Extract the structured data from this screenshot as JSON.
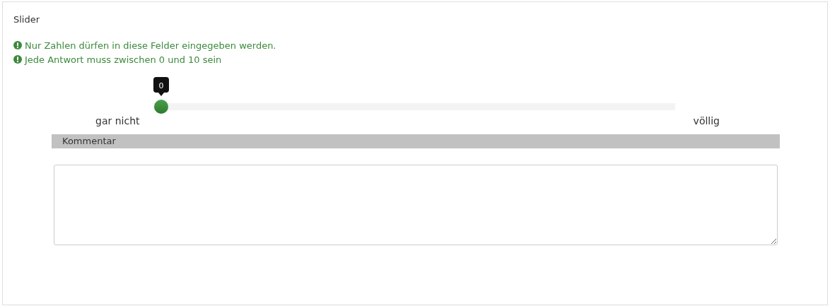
{
  "question": {
    "title": "Slider"
  },
  "messages": [
    "Nur Zahlen dürfen in diese Felder eingegeben werden.",
    "Jede Antwort muss zwischen 0 und 10 sein"
  ],
  "slider": {
    "level": 0,
    "tooltip": "0",
    "min_label": "gar nicht",
    "max_label": "völlig"
  },
  "comment": {
    "label": "Kommentar"
  }
}
